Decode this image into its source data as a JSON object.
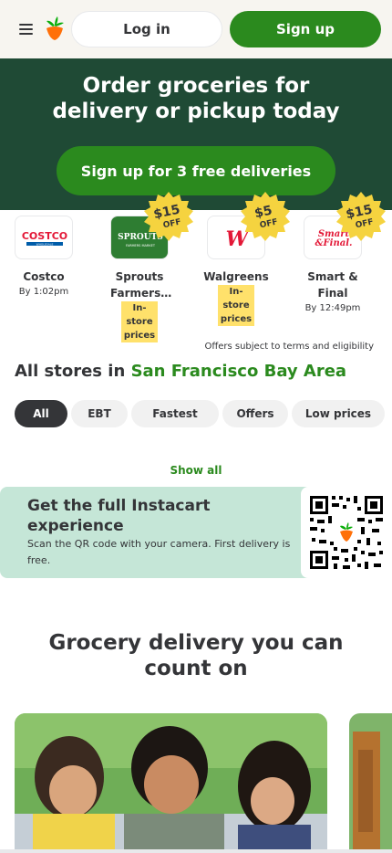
{
  "header": {
    "login_label": "Log in",
    "signup_label": "Sign up",
    "menu_icon": "hamburger-icon",
    "logo_icon": "instacart-carrot-icon"
  },
  "hero": {
    "title_line1": "Order groceries for",
    "title_line2": "delivery or pickup today",
    "cta_label": "Sign up for 3 free deliveries",
    "bg_color": "#1f4a35",
    "accent_color": "#2b8a1e"
  },
  "stores": [
    {
      "name": "Costco",
      "eta": "By 1:02pm",
      "logo_text": "COSTCO",
      "logo_subtext": "WHOLESALE"
    },
    {
      "name": "Sprouts Farmers…",
      "badge": "In-store prices",
      "logo_text": "SPROUTS",
      "logo_subtext": "FARMERS MARKET",
      "offer_amount": "$15",
      "offer_label": "OFF"
    },
    {
      "name": "Walgreens",
      "badge": "In-store prices",
      "logo_text": "W",
      "offer_amount": "$5",
      "offer_label": "OFF"
    },
    {
      "name": "Smart & Final",
      "eta": "By 12:49pm",
      "logo_text": "Smart",
      "logo_subtext": "&Final.",
      "offer_amount": "$15",
      "offer_label": "OFF"
    }
  ],
  "disclaimer": "Offers subject to terms and eligibility",
  "all_stores": {
    "prefix": "All stores in",
    "location": "San Francisco Bay Area"
  },
  "filters": [
    "All",
    "EBT",
    "Fastest",
    "Offers",
    "Low prices"
  ],
  "show_all_label": "Show all",
  "qr_banner": {
    "title": "Get the full Instacart experience",
    "subtitle": "Scan the QR code with your camera. First delivery is free."
  },
  "section_title_line1": "Grocery delivery you can",
  "section_title_line2": "count on"
}
